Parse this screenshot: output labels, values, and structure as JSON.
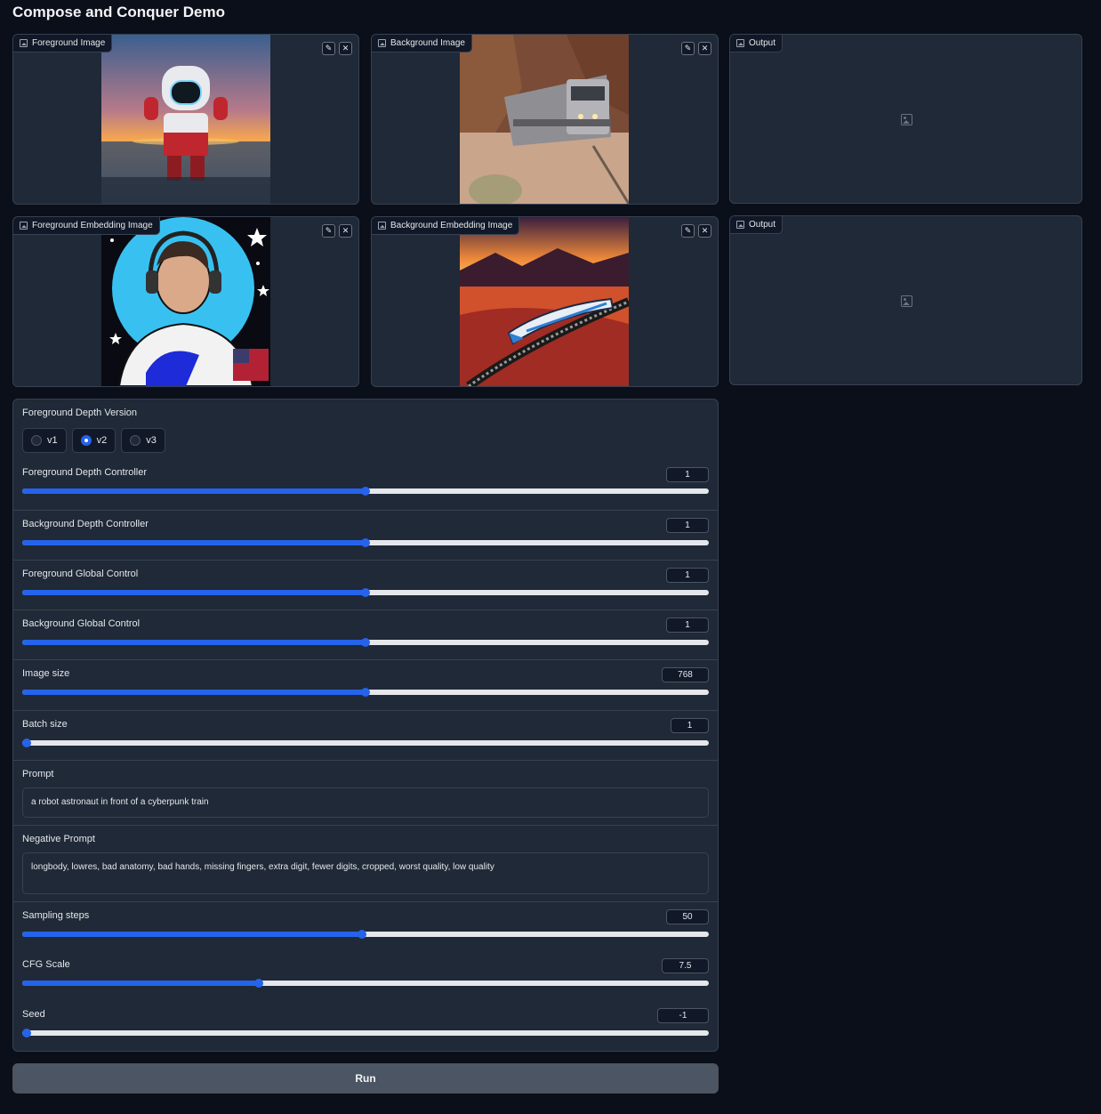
{
  "app": {
    "title": "Compose and Conquer Demo"
  },
  "panels": {
    "foreground_image": {
      "label": "Foreground Image",
      "edit_icon": "pencil-icon",
      "clear_icon": "close-icon"
    },
    "background_image": {
      "label": "Background Image",
      "edit_icon": "pencil-icon",
      "clear_icon": "close-icon"
    },
    "output_1": {
      "label": "Output",
      "icon": "image-placeholder-icon"
    },
    "foreground_embedding": {
      "label": "Foreground Embedding Image",
      "edit_icon": "pencil-icon",
      "clear_icon": "close-icon"
    },
    "background_embedding": {
      "label": "Background Embedding Image",
      "edit_icon": "pencil-icon",
      "clear_icon": "close-icon"
    },
    "output_2": {
      "label": "Output",
      "icon": "image-placeholder-icon"
    }
  },
  "icons": {
    "edit": "✎",
    "clear": "✕"
  },
  "controls": {
    "depth_version": {
      "label": "Foreground Depth Version",
      "options": [
        "v1",
        "v2",
        "v3"
      ],
      "selected": "v2"
    },
    "fg_depth": {
      "label": "Foreground Depth Controller",
      "value": "1",
      "fraction": 0.5
    },
    "bg_depth": {
      "label": "Background Depth Controller",
      "value": "1",
      "fraction": 0.5
    },
    "fg_global": {
      "label": "Foreground Global Control",
      "value": "1",
      "fraction": 0.5
    },
    "bg_global": {
      "label": "Background Global Control",
      "value": "1",
      "fraction": 0.5
    },
    "image_size": {
      "label": "Image size",
      "value": "768",
      "fraction": 0.5
    },
    "batch_size": {
      "label": "Batch size",
      "value": "1",
      "fraction": 0.0
    },
    "prompt": {
      "label": "Prompt",
      "value": "a robot astronaut in front of a cyberpunk train"
    },
    "negative_prompt": {
      "label": "Negative Prompt",
      "value": "longbody, lowres, bad anatomy, bad hands, missing fingers, extra digit, fewer digits, cropped, worst quality, low quality"
    },
    "sampling_steps": {
      "label": "Sampling steps",
      "value": "50",
      "fraction": 0.495
    },
    "cfg_scale": {
      "label": "CFG Scale",
      "value": "7.5",
      "fraction": 0.345
    },
    "seed": {
      "label": "Seed",
      "value": "-1",
      "fraction": 0.0
    }
  },
  "run": {
    "label": "Run"
  },
  "colors": {
    "accent": "#2563eb",
    "background": "#0b0f19",
    "panel": "#1f2937"
  }
}
